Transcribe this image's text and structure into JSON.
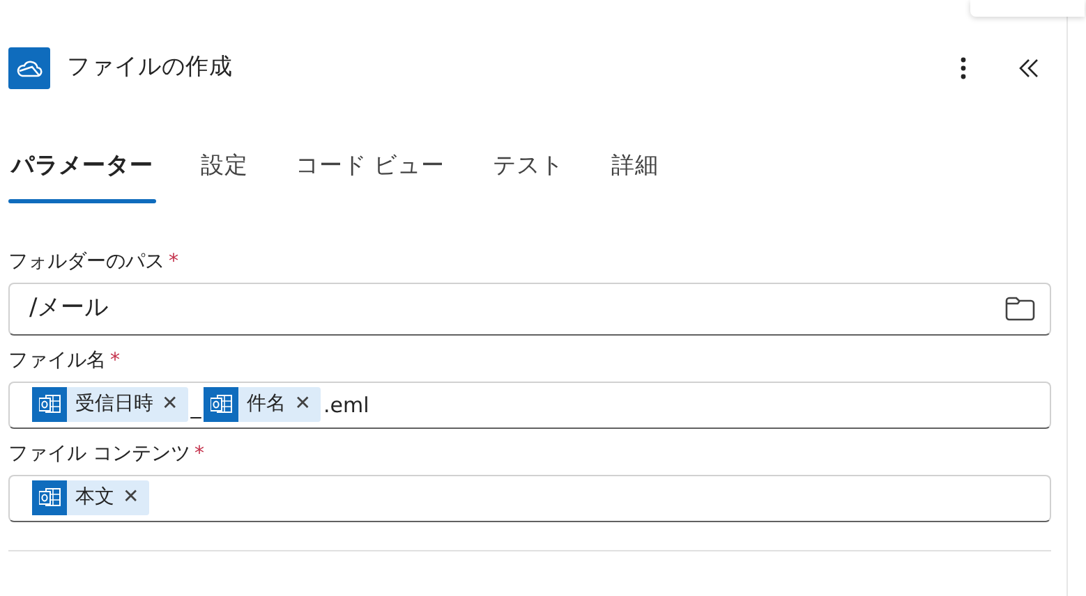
{
  "header": {
    "title": "ファイルの作成"
  },
  "tabs": [
    {
      "label": "パラメーター",
      "selected": true
    },
    {
      "label": "設定",
      "selected": false
    },
    {
      "label": "コード ビュー",
      "selected": false
    },
    {
      "label": "テスト",
      "selected": false
    },
    {
      "label": "詳細",
      "selected": false
    }
  ],
  "fields": [
    {
      "label": "フォルダーのパス",
      "required": "*",
      "kind": "picker",
      "value": "/メール"
    },
    {
      "label": "ファイル名",
      "required": "*",
      "kind": "tokens",
      "parts": [
        {
          "kind": "token",
          "text": "受信日時",
          "remove": "✕"
        },
        {
          "kind": "text",
          "text": "_"
        },
        {
          "kind": "token",
          "text": "件名",
          "remove": "✕"
        },
        {
          "kind": "text",
          "text": ".eml"
        }
      ]
    },
    {
      "label": "ファイル コンテンツ",
      "required": "*",
      "kind": "tokens",
      "parts": [
        {
          "kind": "token",
          "text": "本文",
          "remove": "✕"
        }
      ]
    }
  ]
}
